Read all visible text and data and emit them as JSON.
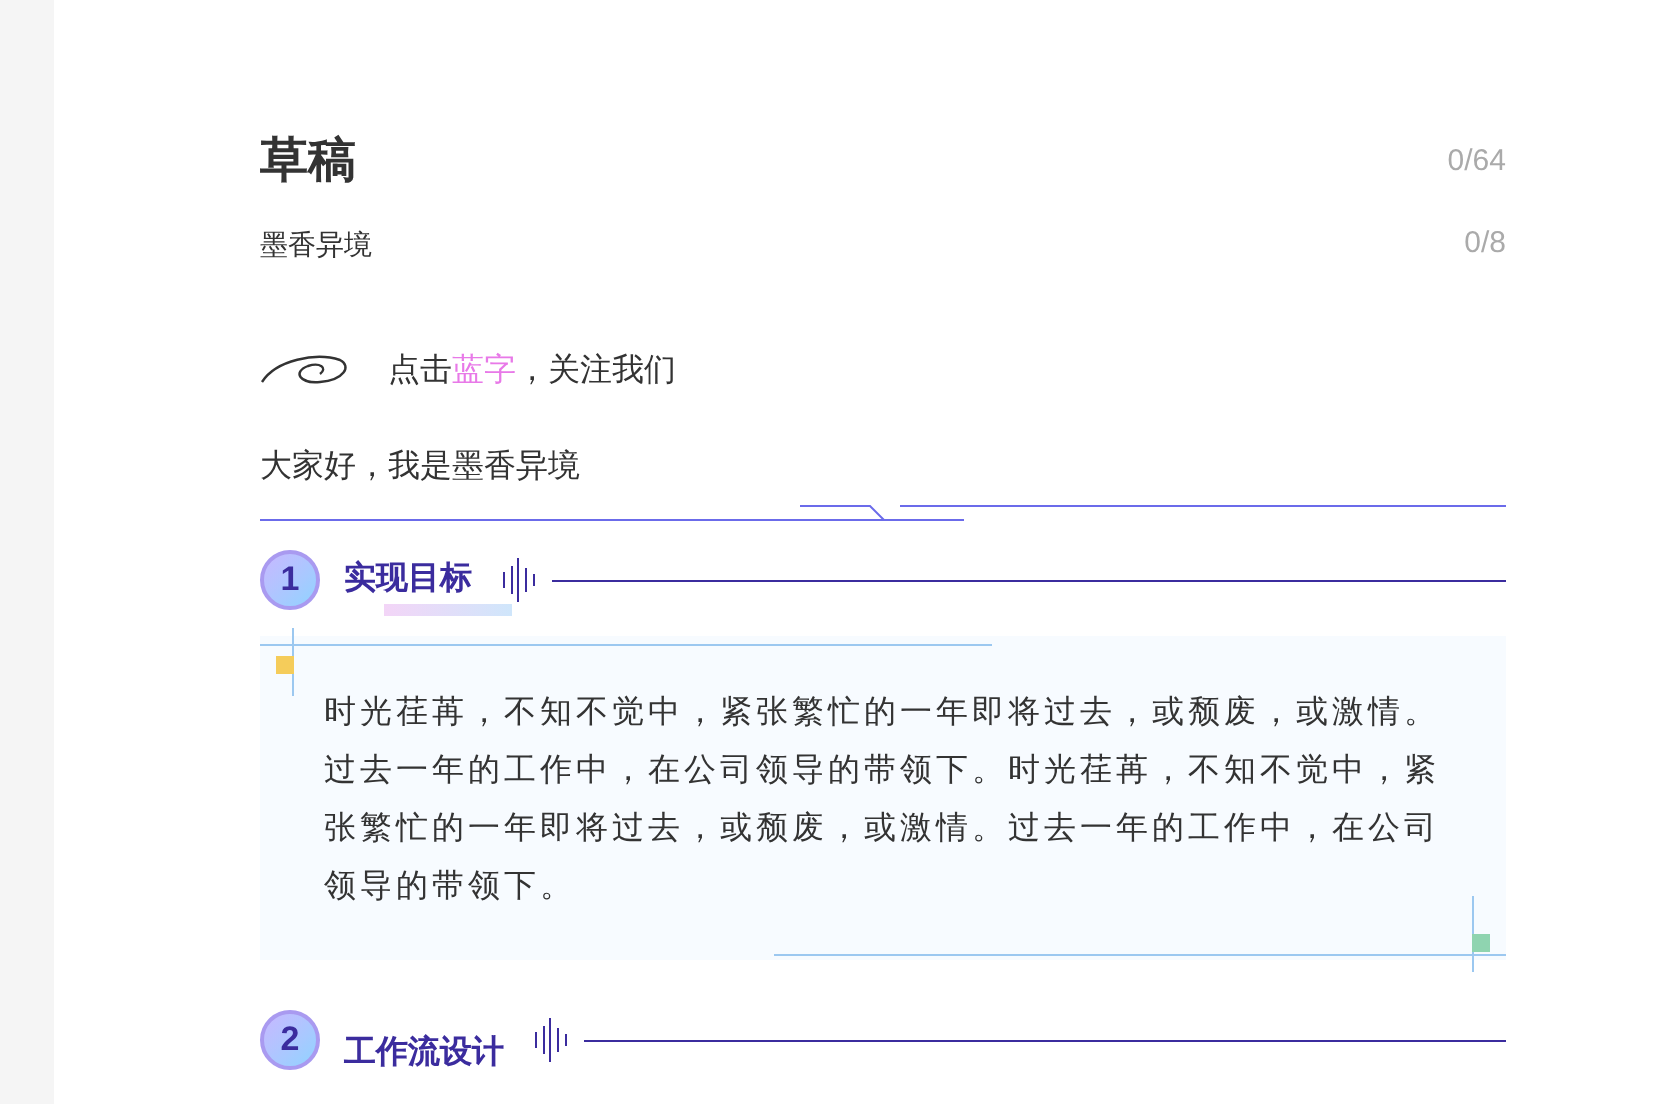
{
  "title": "草稿",
  "title_count": "0/64",
  "author": "墨香异境",
  "author_count": "0/8",
  "follow": {
    "prefix": "点击",
    "highlight": "蓝字",
    "suffix": "，关注我们"
  },
  "greeting": "大家好，我是墨香异境",
  "sections": [
    {
      "number": "1",
      "title": "实现目标",
      "body": "时光荏苒，不知不觉中，紧张繁忙的一年即将过去，或颓废，或激情。过去一年的工作中，在公司领导的带领下。时光荏苒，不知不觉中，紧张繁忙的一年即将过去，或颓废，或激情。过去一年的工作中，在公司领导的带领下。"
    },
    {
      "number": "2",
      "title": "工作流设计"
    }
  ]
}
